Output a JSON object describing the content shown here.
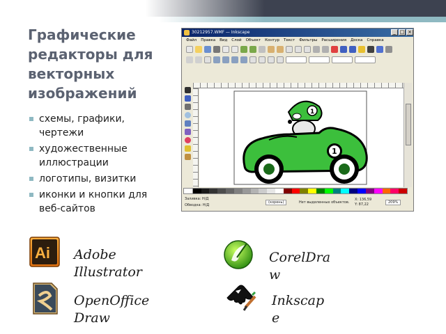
{
  "slide": {
    "title": "Графические редакторы для векторных изображений",
    "bullets": [
      "схемы, графики, чертежи",
      "художественные иллюстрации",
      "логотипы, визитки",
      "иконки и кнопки для веб-сайтов"
    ],
    "accent_color": "#8fb9c2",
    "title_color": "#5b6271"
  },
  "inkscape_window": {
    "title": "30212957.WMF — Inkscape",
    "menu": [
      "Файл",
      "Правка",
      "Вид",
      "Слой",
      "Объект",
      "Контур",
      "Текст",
      "Фильтры",
      "Расширения",
      "Доска",
      "Справка"
    ],
    "car_number": "1",
    "status": {
      "fill_label": "Заливка:",
      "stroke_label": "Обводка:",
      "fill_value": "Н/Д",
      "stroke_value": "Н/Д",
      "layer": "(корень)",
      "message": "Нет выделенных объектов.",
      "x_label": "X:",
      "y_label": "Y:",
      "x_value": "136,59",
      "y_value": "87,22",
      "zoom": "209%"
    }
  },
  "apps": [
    {
      "name": "Adobe Illustrator",
      "line1": "Adobe",
      "line2": "Illustrator",
      "icon": "illustrator-icon",
      "icon_text": "Ai"
    },
    {
      "name": "CorelDraw",
      "line1": "CorelDra",
      "line2": "w",
      "icon": "coreldraw-icon"
    },
    {
      "name": "OpenOffice Draw",
      "line1": "OpenOffice",
      "line2": "Draw",
      "icon": "openoffice-draw-icon"
    },
    {
      "name": "Inkscape",
      "line1": "Inkscap",
      "line2": "e",
      "icon": "inkscape-icon"
    }
  ]
}
